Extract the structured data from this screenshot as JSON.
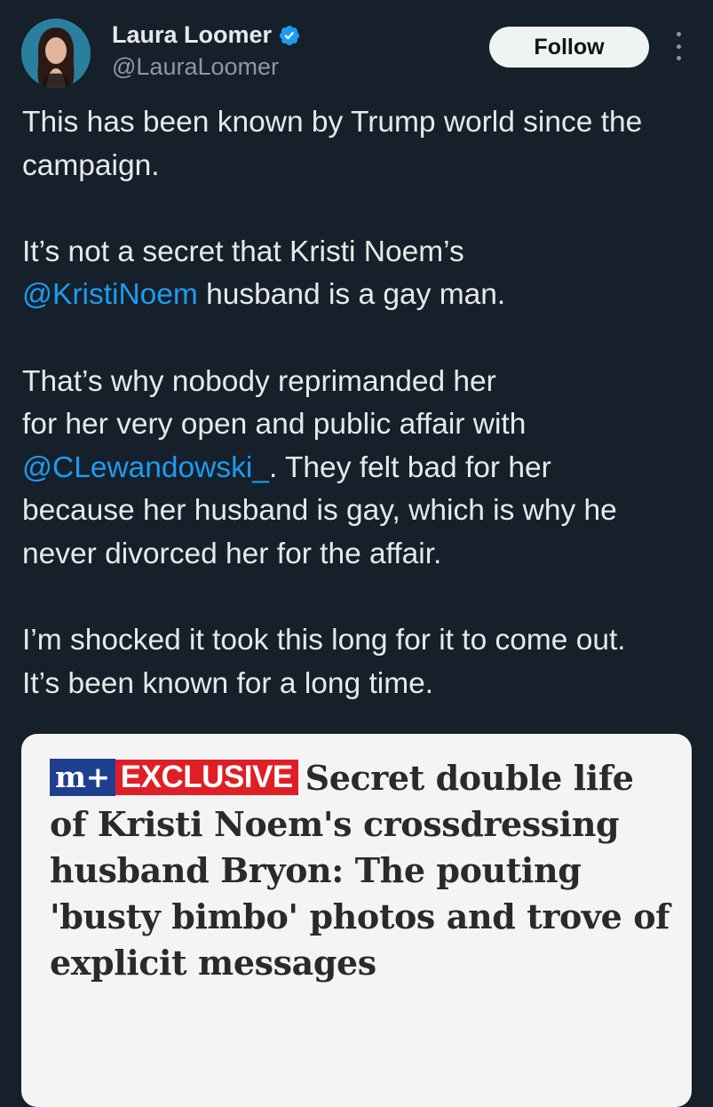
{
  "author": {
    "display_name": "Laura Loomer",
    "handle": "@LauraLoomer",
    "verified_icon": "verified-badge-icon",
    "accent": "#1d9bf0"
  },
  "actions": {
    "follow_label": "Follow",
    "more_icon": "more-vertical-icon"
  },
  "tweet": {
    "p1": "This has been known by Trump world since the campaign.",
    "p2_a": "It’s not a secret that Kristi Noem’s ",
    "p2_mention": "@KristiNoem",
    "p2_b": " husband is a gay man.",
    "p3_a": "That’s why nobody reprimanded her ",
    "p3_b": "for her very open and public affair with ",
    "p3_mention": "@CLewandowski_",
    "p3_c": ". They felt bad for her because her husband is gay, which is why he never divorced her for the affair.",
    "p4": "I’m shocked it took this long for it to come out. It’s been known for a long time."
  },
  "card": {
    "logo_text": "m+",
    "exclusive_label": "EXCLUSIVE",
    "headline": "Secret double life of Kristi Noem's crossdressing husband Bryon: The pouting 'busty bimbo' photos and trove of explicit messages"
  },
  "colors": {
    "background": "#15202b",
    "text": "#e7e9ea",
    "muted": "#8b98a5",
    "mention": "#1d9bf0",
    "exclusive_red": "#e01e26",
    "logo_blue": "#1e3f8f"
  }
}
